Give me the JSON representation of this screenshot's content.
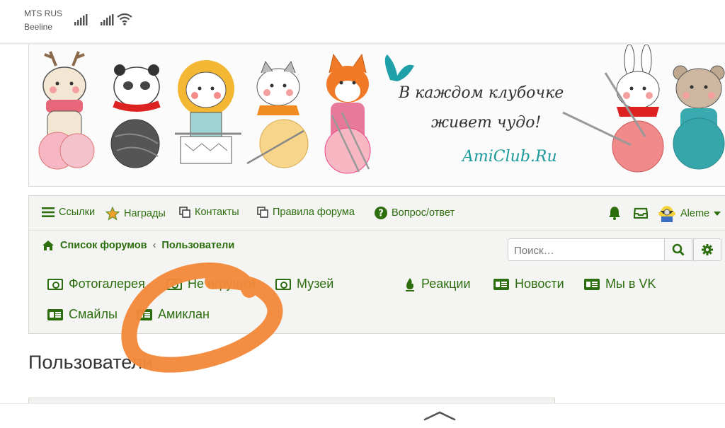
{
  "status_bar": {
    "carrier_1": "MTS RUS",
    "carrier_2": "Beeline"
  },
  "banner": {
    "slogan_line_1": "В каждом клубочке",
    "slogan_line_2": "живет чудо!",
    "site_name": "AmiClub.Ru"
  },
  "nav": {
    "links": "Ссылки",
    "awards": "Награды",
    "contacts": "Контакты",
    "rules": "Правила форума",
    "faq": "Вопрос/ответ",
    "user": "Aleme"
  },
  "breadcrumb": {
    "home": "Список форумов",
    "separator": "‹",
    "current": "Пользователи"
  },
  "search": {
    "placeholder": "Поиск…"
  },
  "quick_links": {
    "photo": "Фотогалерея",
    "toys": "Не игрушки",
    "museum": "Музей",
    "reactions": "Реакции",
    "news": "Новости",
    "vk": "Мы в VK",
    "smiles": "Смайлы",
    "amiclan": "Амиклан"
  },
  "page": {
    "title": "Пользователи"
  },
  "colors": {
    "accent_green": "#2c6e0e",
    "annotation_orange": "#f2883a",
    "site_teal": "#1a9a9a"
  }
}
